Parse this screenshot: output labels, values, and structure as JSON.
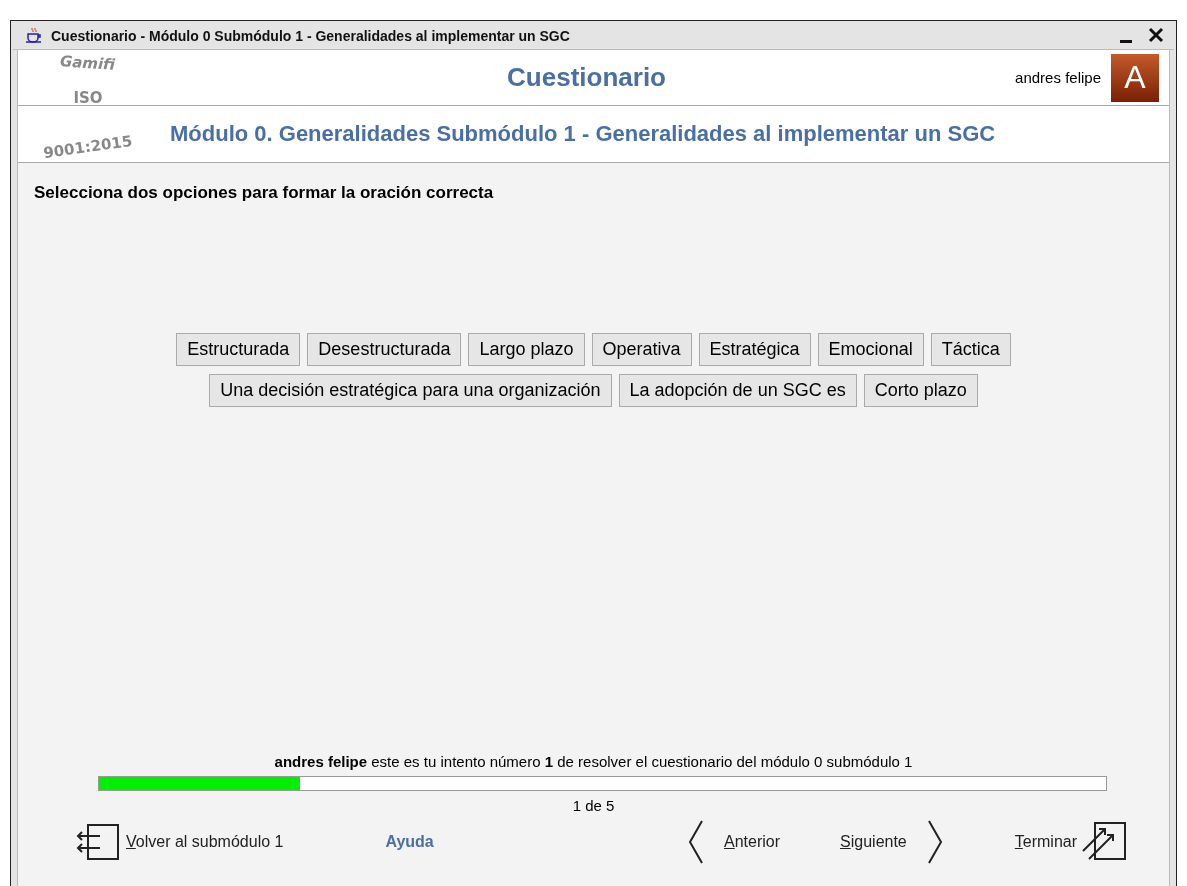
{
  "window": {
    "title": "Cuestionario - Módulo 0 Submódulo 1 - Generalidades al implementar un SGC"
  },
  "logo": {
    "line_1": "Gamifi",
    "line_2": "ISO",
    "line_3": "9001:2015"
  },
  "header": {
    "title": "Cuestionario",
    "user_name": "andres felipe",
    "avatar_letter": "A",
    "module_title": "Módulo 0. Generalidades Submódulo 1 - Generalidades al implementar un SGC"
  },
  "instruction": "Selecciona dos opciones para formar la oración correcta",
  "option_rows": [
    [
      "Estructurada",
      "Desestructurada",
      "Largo plazo",
      "Operativa",
      "Estratégica",
      "Emocional",
      "Táctica"
    ],
    [
      "Una decisión estratégica para una organización",
      "La adopción de un SGC es",
      "Corto plazo"
    ]
  ],
  "attempt_text": "**andres felipe** este es tu intento número **1** de resolver el cuestionario del módulo 0 submódulo 1",
  "progress": {
    "level": 0.2,
    "label": "1 de 5"
  },
  "footer": {
    "back": "Volver al submódulo 1",
    "help": "Ayuda",
    "previous": "Anterior",
    "next": "Siguiente",
    "finish": "Terminar"
  }
}
